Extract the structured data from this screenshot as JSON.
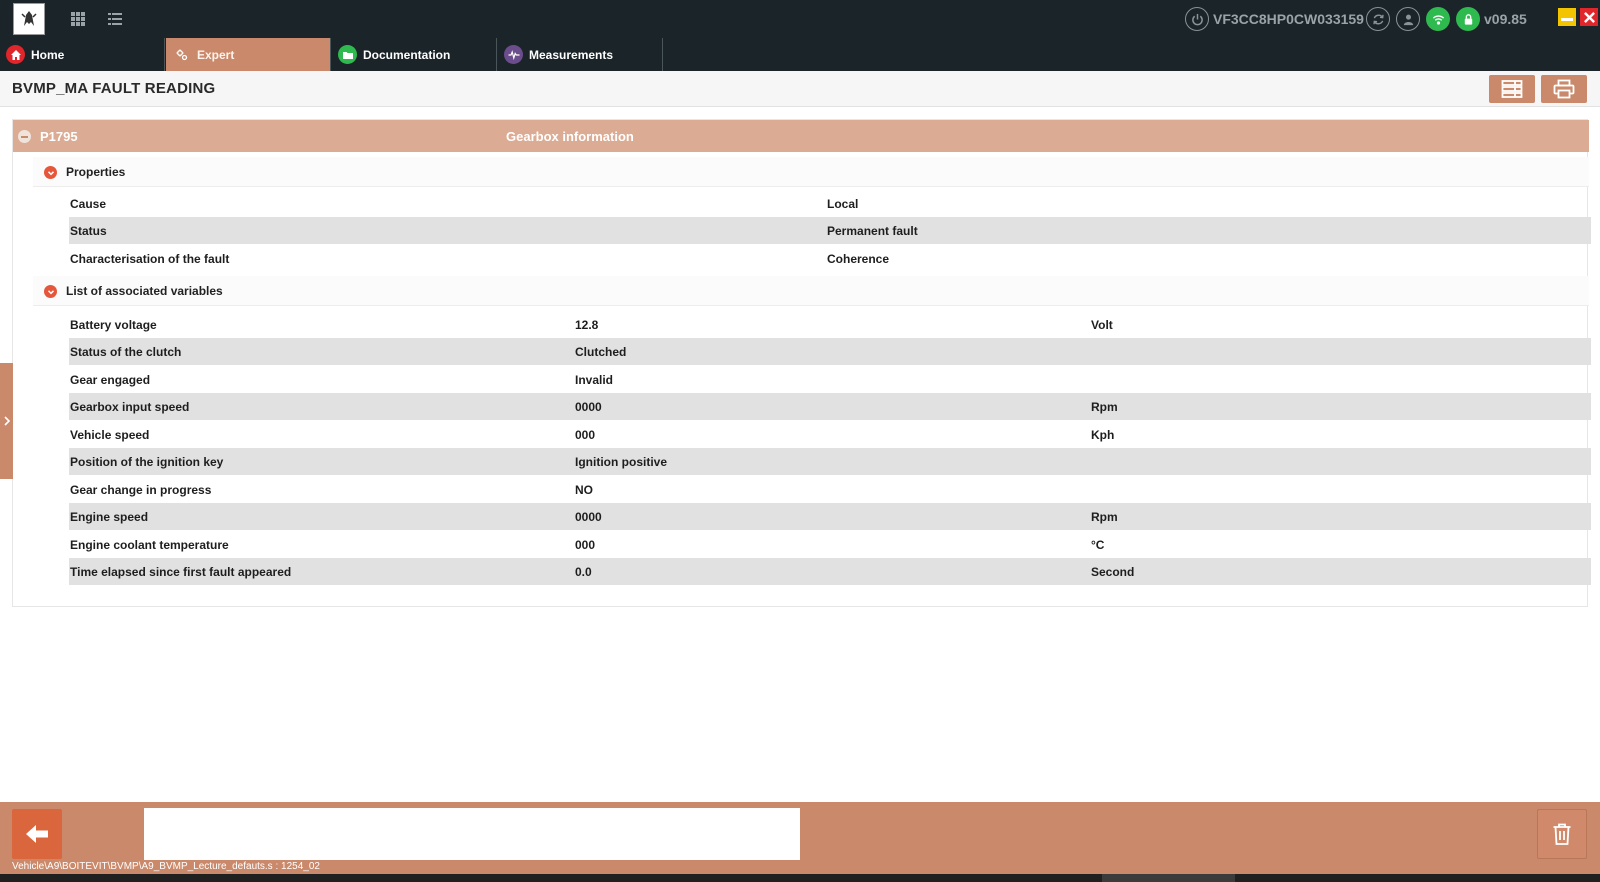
{
  "header": {
    "vin": "VF3CC8HP0CW033159",
    "version": "v09.85",
    "icons": [
      "grid-icon",
      "list-icon",
      "power-icon",
      "refresh-icon",
      "user-icon",
      "wifi-icon",
      "lock-icon"
    ]
  },
  "tabs": [
    {
      "label": "Home",
      "icon": "home-icon"
    },
    {
      "label": "Expert",
      "icon": "expert-icon"
    },
    {
      "label": "Documentation",
      "icon": "folder-icon"
    },
    {
      "label": "Measurements",
      "icon": "waveform-icon"
    }
  ],
  "page": {
    "title": "BVMP_MA FAULT READING"
  },
  "fault": {
    "code": "P1795",
    "description": "Gearbox information"
  },
  "properties": {
    "title": "Properties",
    "rows": [
      {
        "label": "Cause",
        "value": "Local"
      },
      {
        "label": "Status",
        "value": "Permanent fault"
      },
      {
        "label": "Characterisation of the fault",
        "value": "Coherence"
      }
    ]
  },
  "variables": {
    "title": "List of associated variables",
    "rows": [
      {
        "label": "Battery voltage",
        "value": "12.8",
        "unit": "Volt"
      },
      {
        "label": "Status of the clutch",
        "value": "Clutched",
        "unit": ""
      },
      {
        "label": "Gear engaged",
        "value": "Invalid",
        "unit": ""
      },
      {
        "label": "Gearbox input speed",
        "value": "0000",
        "unit": "Rpm"
      },
      {
        "label": "Vehicle speed",
        "value": "000",
        "unit": "Kph"
      },
      {
        "label": "Position of the ignition key",
        "value": "Ignition positive",
        "unit": ""
      },
      {
        "label": "Gear change in progress",
        "value": "NO",
        "unit": ""
      },
      {
        "label": "Engine speed",
        "value": "0000",
        "unit": "Rpm"
      },
      {
        "label": "Engine coolant temperature",
        "value": "000",
        "unit": "°C"
      },
      {
        "label": "Time elapsed since first fault appeared",
        "value": "0.0",
        "unit": "Second"
      }
    ]
  },
  "footer": {
    "path": "Vehicle\\A9\\BOITEVIT\\BVMP\\A9_BVMP_Lecture_defauts.s : 1254_02"
  },
  "colors": {
    "accent": "#c9896a",
    "fault_header": "#dbab93",
    "topbar": "#1b2428",
    "toggle_red": "#e5563b",
    "status_green": "#2fba4f"
  }
}
